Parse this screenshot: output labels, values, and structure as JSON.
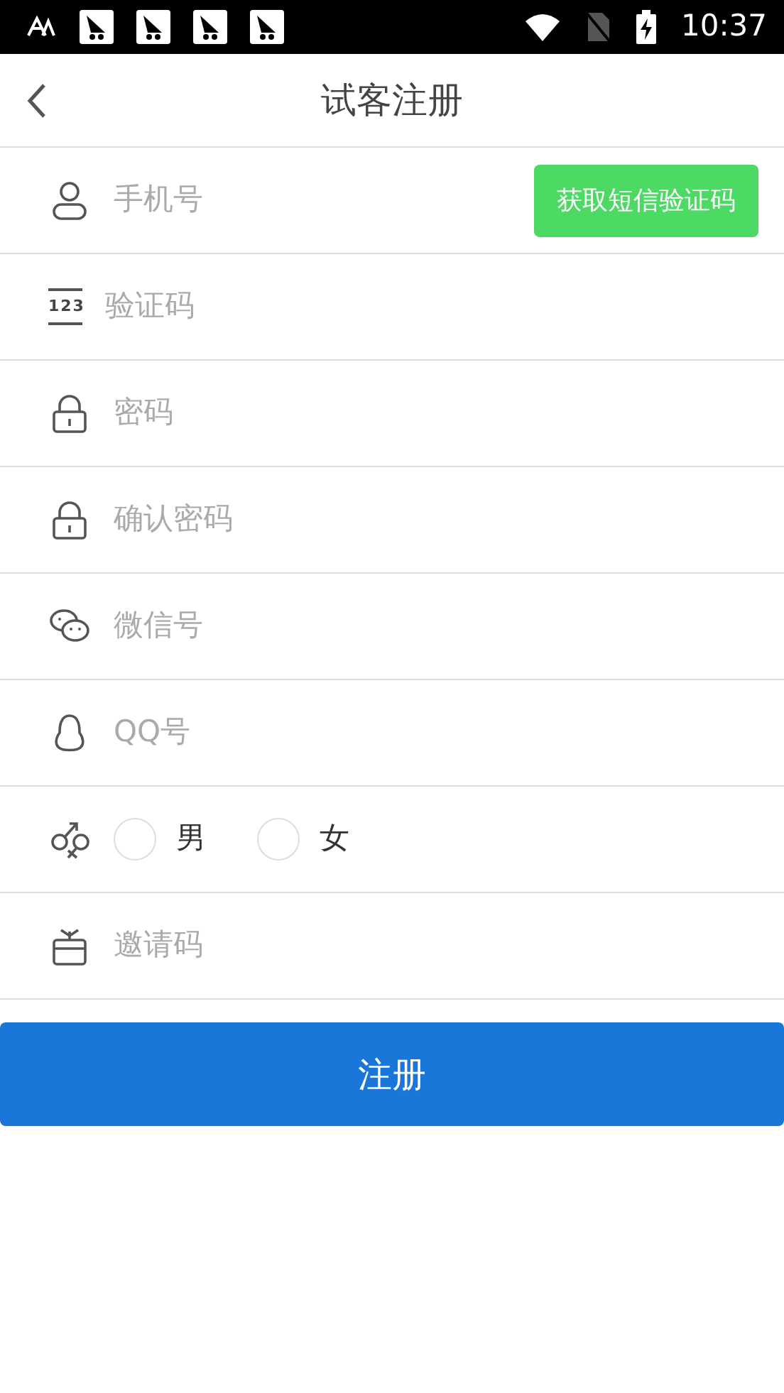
{
  "status_bar": {
    "time": "10:37"
  },
  "header": {
    "title": "试客注册"
  },
  "fields": [
    {
      "kind": "input",
      "placeholder": "手机号",
      "button": "获取短信验证码"
    },
    {
      "kind": "input",
      "placeholder": "验证码",
      "icon_label": "123"
    },
    {
      "kind": "input",
      "placeholder": "密码"
    },
    {
      "kind": "input",
      "placeholder": "确认密码"
    },
    {
      "kind": "input",
      "placeholder": "微信号"
    },
    {
      "kind": "input",
      "placeholder": "QQ号"
    },
    {
      "kind": "gender",
      "options": [
        {
          "label": "男",
          "selected": false
        },
        {
          "label": "女",
          "selected": false
        }
      ]
    },
    {
      "kind": "input",
      "placeholder": "邀请码"
    }
  ],
  "submit": "注册"
}
